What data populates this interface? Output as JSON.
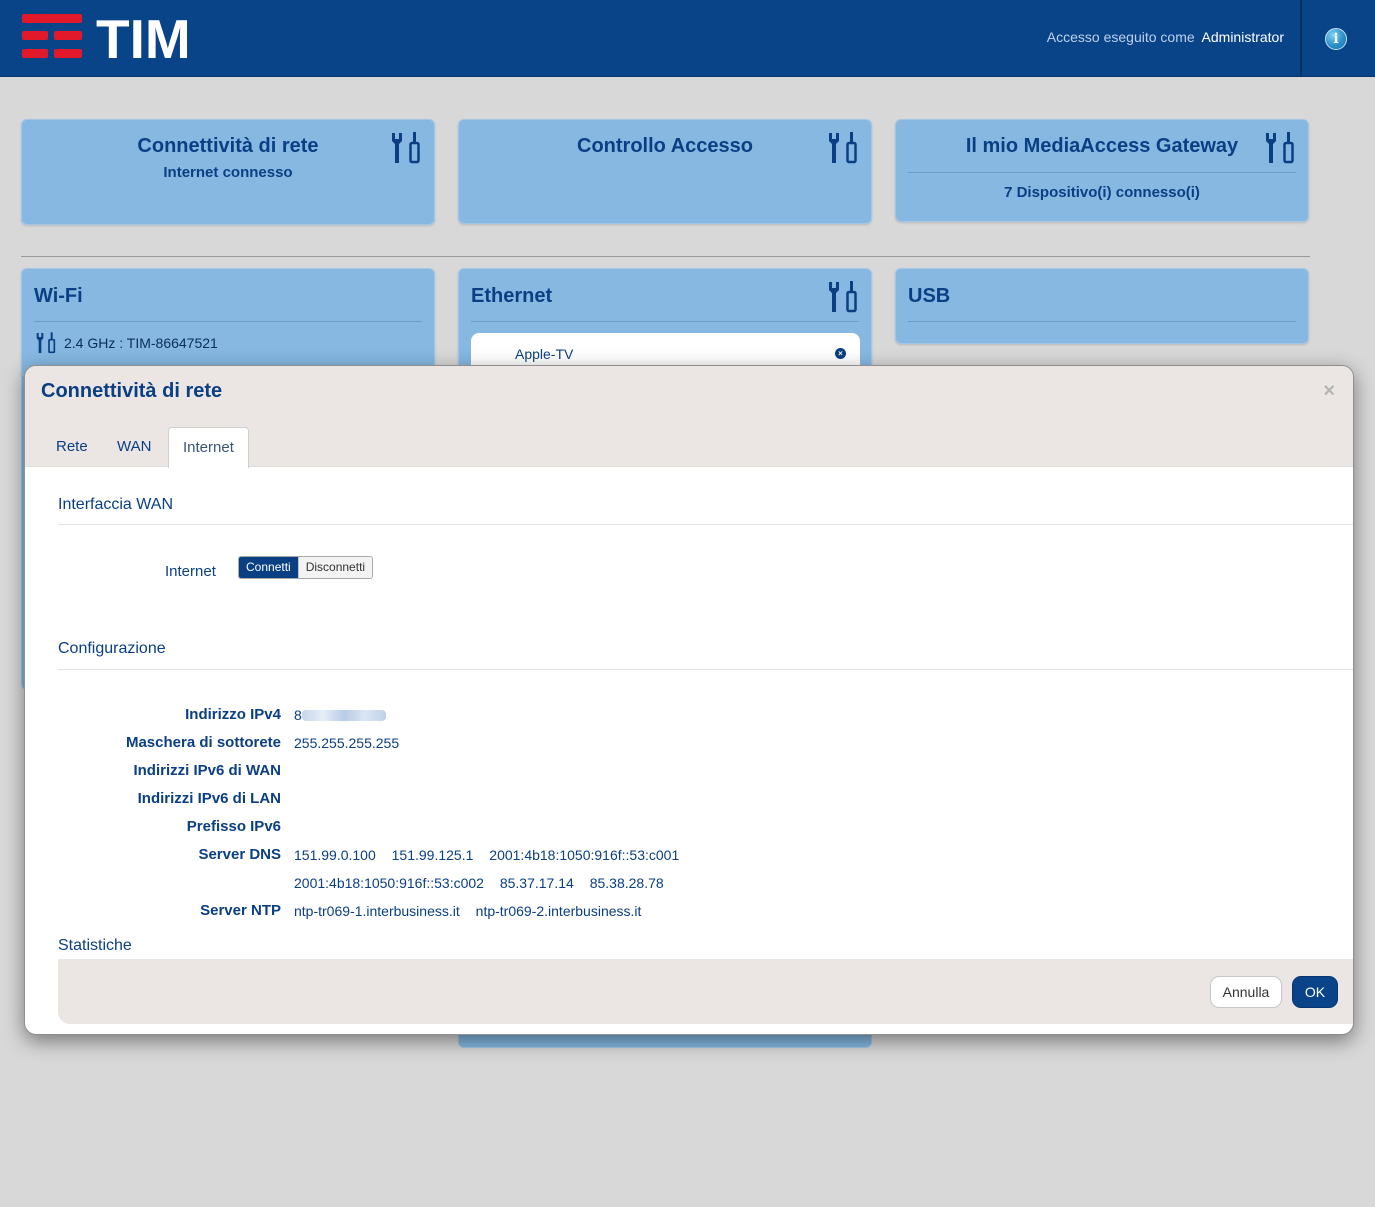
{
  "header": {
    "logo_text": "TIM",
    "login_prefix": "Accesso eseguito come",
    "login_user": "Administrator",
    "info_icon": "info-icon"
  },
  "tiles": {
    "network": {
      "title": "Connettività di rete",
      "subtitle": "Internet connesso"
    },
    "access": {
      "title": "Controllo Accesso"
    },
    "gateway": {
      "title": "Il mio MediaAccess Gateway",
      "subtitle": "7 Dispositivo(i) connesso(i)"
    },
    "wifi": {
      "title": "Wi-Fi",
      "network": "2.4 GHz : TIM-86647521"
    },
    "ethernet": {
      "title": "Ethernet",
      "device": "Apple-TV"
    },
    "usb": {
      "title": "USB"
    }
  },
  "modal": {
    "title": "Connettività di rete",
    "close": "×",
    "tabs": [
      {
        "label": "Rete",
        "active": false
      },
      {
        "label": "WAN",
        "active": false
      },
      {
        "label": "Internet",
        "active": true
      }
    ],
    "wan_section": "Interfaccia WAN",
    "internet_label": "Internet",
    "toggle": {
      "on": "Connetti",
      "off": "Disconnetti",
      "selected": "Connetti"
    },
    "config_section": "Configurazione",
    "rows": {
      "ipv4": {
        "label": "Indirizzo IPv4",
        "value_prefix": "8"
      },
      "mask": {
        "label": "Maschera di sottorete",
        "value": "255.255.255.255"
      },
      "ipv6_wan": {
        "label": "Indirizzi IPv6 di WAN"
      },
      "ipv6_lan": {
        "label": "Indirizzi IPv6 di LAN"
      },
      "ipv6_prefix": {
        "label": "Prefisso IPv6"
      },
      "dns": {
        "label": "Server DNS",
        "values": [
          "151.99.0.100",
          "151.99.125.1",
          "2001:4b18:1050:916f::53:c001",
          "2001:4b18:1050:916f::53:c002",
          "85.37.17.14",
          "85.38.28.78"
        ]
      },
      "ntp": {
        "label": "Server NTP",
        "values": [
          "ntp-tr069-1.interbusiness.it",
          "ntp-tr069-2.interbusiness.it"
        ]
      }
    },
    "stats_section": "Statistiche",
    "buttons": {
      "cancel": "Annulla",
      "ok": "OK"
    }
  },
  "colors": {
    "header_bg": "#0a4488",
    "tile_bg": "#86b8e2",
    "accent_text": "#0a3f83",
    "page_bg": "#d8d8d8",
    "logo_red": "#e2192a"
  }
}
